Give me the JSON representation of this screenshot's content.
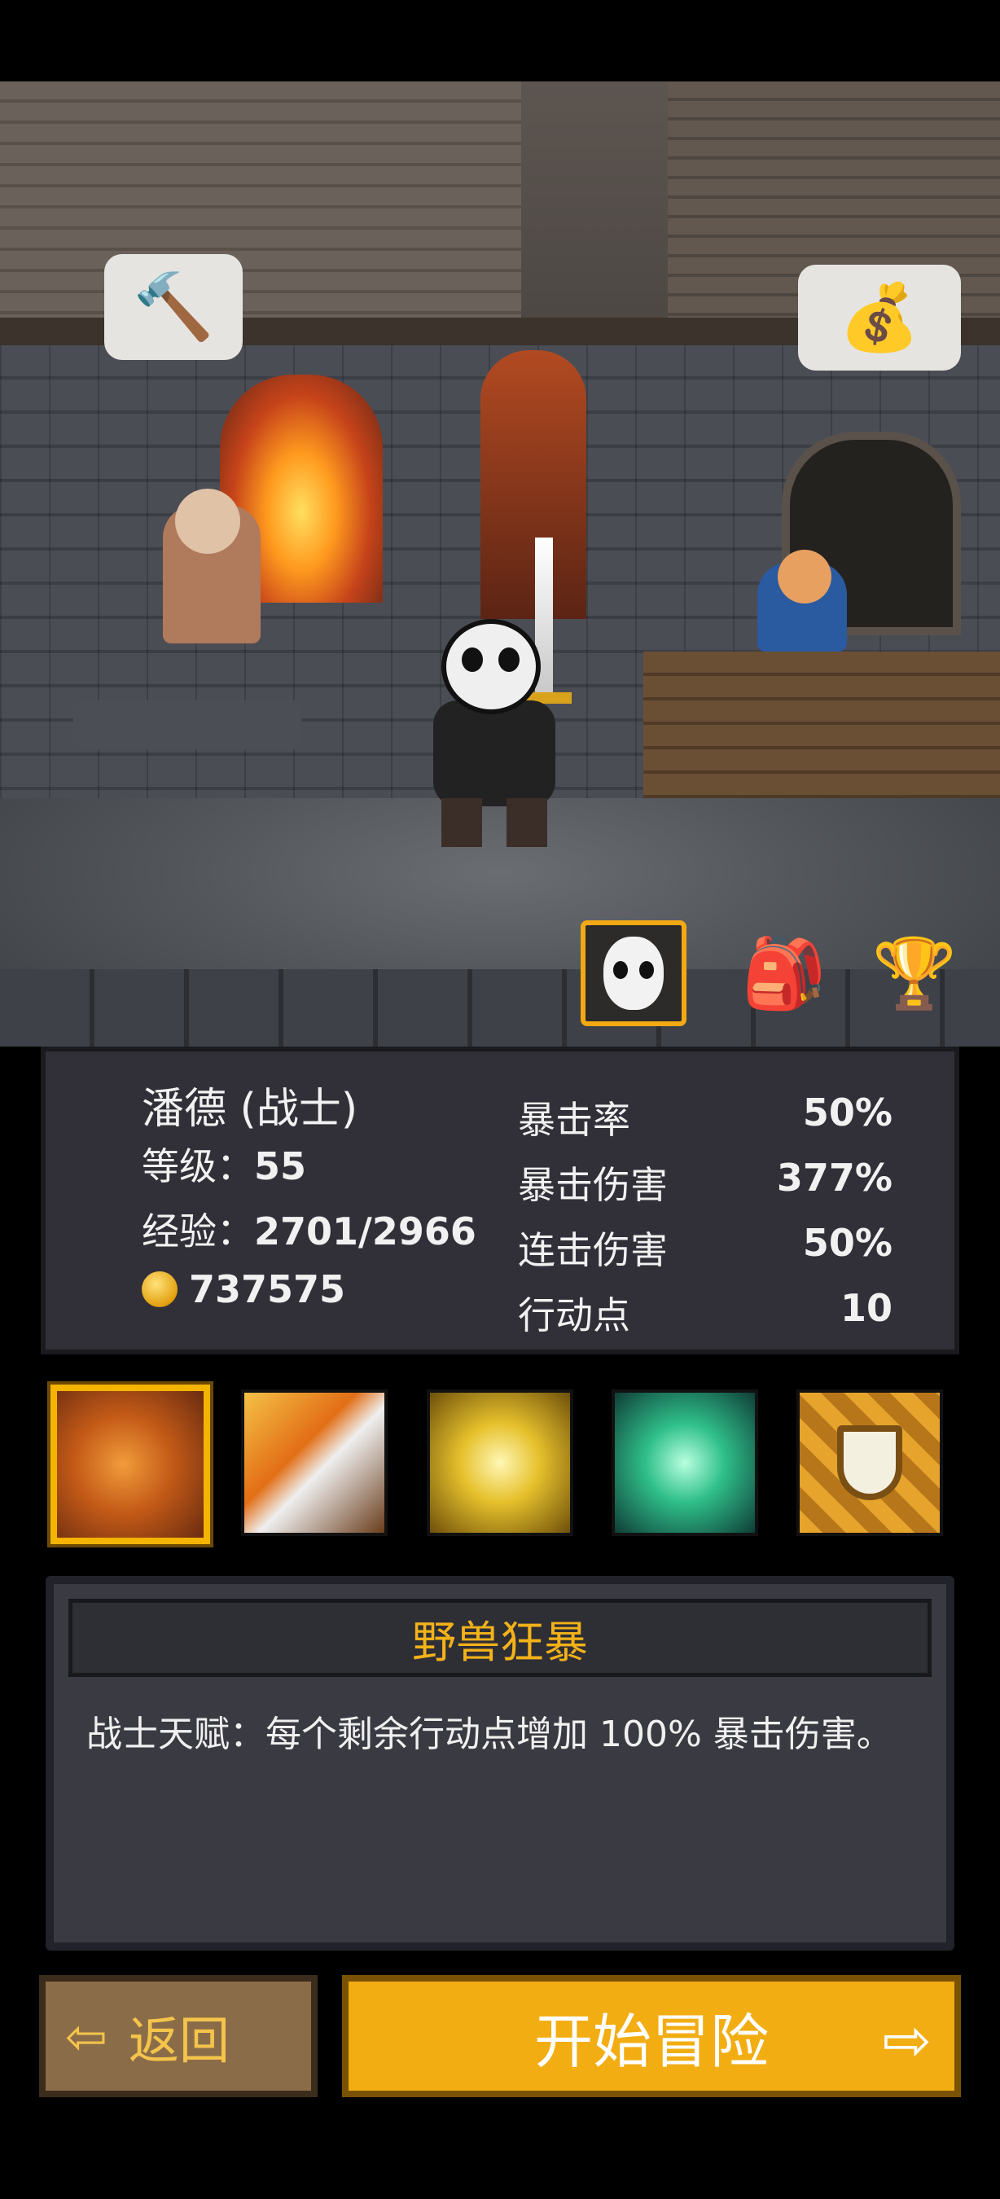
{
  "character": {
    "name": "潘德 (战士)",
    "level_label": "等级：",
    "level": "55",
    "exp_label": "经验：",
    "exp": "2701/2966",
    "gold": "737575"
  },
  "stats": [
    {
      "label": "暴击率",
      "value": "50%"
    },
    {
      "label": "暴击伤害",
      "value": "377%"
    },
    {
      "label": "连击伤害",
      "value": "50%"
    },
    {
      "label": "行动点",
      "value": "10"
    }
  ],
  "skills": [
    "beast-rage-icon",
    "blade-strike-icon",
    "golden-armor-icon",
    "green-potion-icon",
    "shield-icon"
  ],
  "selected_skill": {
    "title": "野兽狂暴",
    "description": "战士天赋：每个剩余行动点增加 100% 暴击伤害。"
  },
  "buttons": {
    "back": "返回",
    "start": "开始冒险"
  },
  "icons": {
    "hammer": "hammer-icon",
    "money_bag": "money-bag-icon",
    "character": "character-portrait-icon",
    "backpack": "backpack-icon",
    "trophy": "trophy-icon"
  },
  "colors": {
    "accent": "#f2ad13",
    "title": "#f3b219",
    "panel": "#313038"
  }
}
